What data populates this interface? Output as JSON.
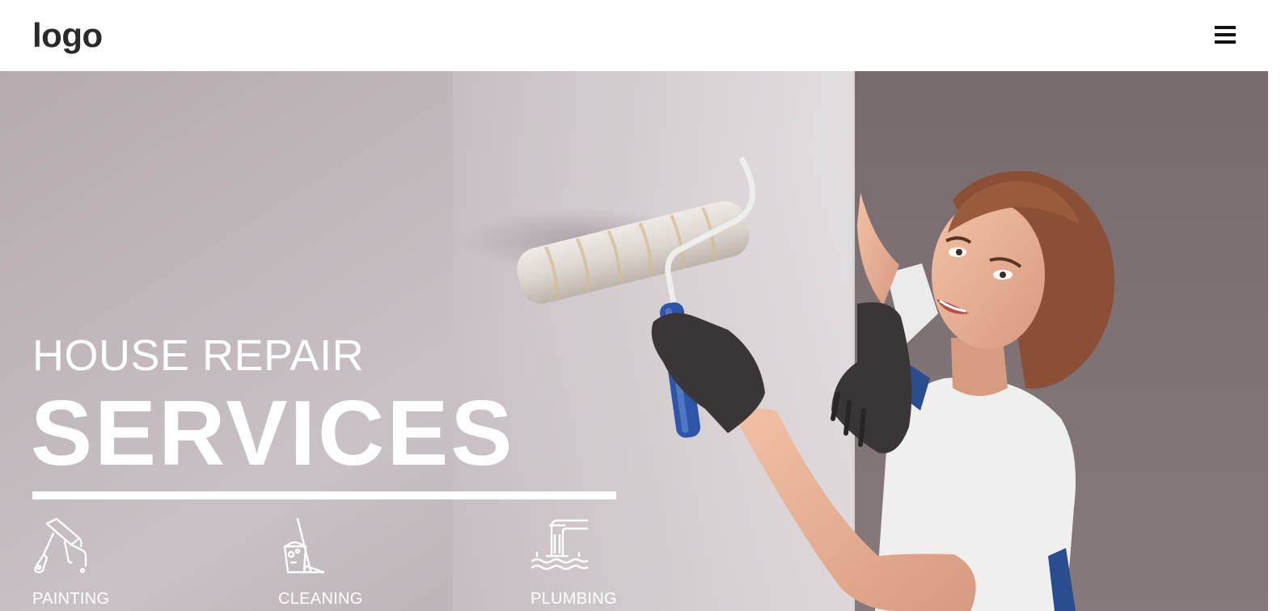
{
  "header": {
    "logo_text": "logo",
    "menu_icon": "hamburger-menu-icon"
  },
  "hero": {
    "title_small": "HOUSE REPAIR",
    "title_big": "SERVICES",
    "services": [
      {
        "label": "PAINTING",
        "icon": "paint-roller-icon"
      },
      {
        "label": "CLEANING",
        "icon": "bucket-broom-icon"
      },
      {
        "label": "PLUMBING",
        "icon": "faucet-water-icon"
      }
    ]
  },
  "colors": {
    "header_bg": "#ffffff",
    "logo_text": "#2a2a2a",
    "hero_text": "#ffffff",
    "wall_left": "#bfb6ba",
    "wall_right": "#7d7173"
  }
}
